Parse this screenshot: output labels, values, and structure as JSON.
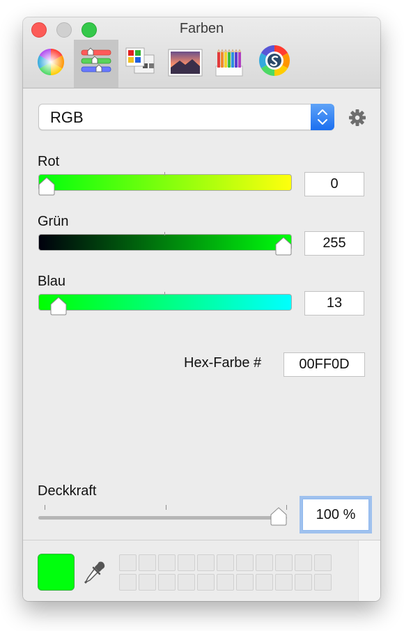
{
  "window": {
    "title": "Farben"
  },
  "tabs": [
    {
      "id": "color-wheel",
      "selected": false
    },
    {
      "id": "color-sliders",
      "selected": true
    },
    {
      "id": "color-palettes",
      "selected": false
    },
    {
      "id": "image-palettes",
      "selected": false
    },
    {
      "id": "pencils",
      "selected": false
    },
    {
      "id": "spectrum-app",
      "selected": false
    }
  ],
  "model": {
    "value": "RGB"
  },
  "sliders": {
    "red": {
      "label": "Rot",
      "value": "0",
      "fraction": 0.0
    },
    "green": {
      "label": "Grün",
      "value": "255",
      "fraction": 1.0
    },
    "blue": {
      "label": "Blau",
      "value": "13",
      "fraction": 0.051
    }
  },
  "hex": {
    "label": "Hex-Farbe #",
    "value": "00FF0D"
  },
  "opacity": {
    "label": "Deckkraft",
    "value": "100 %",
    "fraction": 1.0
  },
  "current_color": "#00FF0D",
  "icons": [
    "settings-gear-icon",
    "eyedropper-icon"
  ]
}
